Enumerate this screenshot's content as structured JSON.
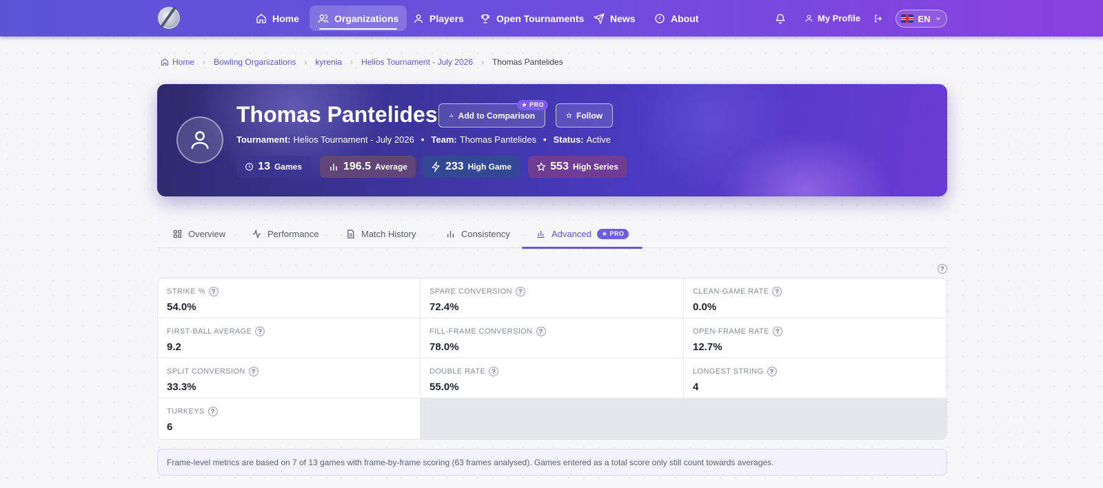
{
  "nav": {
    "items": [
      {
        "label": "Home",
        "icon": "home-icon"
      },
      {
        "label": "Organizations",
        "icon": "users-icon",
        "active": true
      },
      {
        "label": "Players",
        "icon": "user-icon"
      },
      {
        "label": "Open Tournaments",
        "icon": "trophy-icon"
      },
      {
        "label": "News",
        "icon": "send-icon"
      },
      {
        "label": "About",
        "icon": "info-icon"
      }
    ],
    "my_profile": "My Profile",
    "language": "EN"
  },
  "breadcrumb": {
    "home": "Home",
    "organizations": "Bowling Organizations",
    "org": "kyrenia",
    "tournament": "Helios Tournament - July 2026",
    "current": "Thomas Pantelides"
  },
  "player": {
    "name": "Thomas Pantelides",
    "add_comparison": "Add to Comparison",
    "pro_badge": "★ PRO",
    "follow": "Follow",
    "tournament_label": "Tournament:",
    "tournament": "Helios Tournament - July 2026",
    "team_label": "Team:",
    "team": "Thomas Pantelides",
    "status_label": "Status:",
    "status": "Active",
    "separator": "•"
  },
  "stats": {
    "games": {
      "value": "13",
      "label": "Games",
      "color": "#3b3790"
    },
    "average": {
      "value": "196.5",
      "label": "Average",
      "color": "#6a4a6e"
    },
    "high_game": {
      "value": "233",
      "label": "High Game",
      "color": "#2f4d8e"
    },
    "high_series": {
      "value": "553",
      "label": "High Series",
      "color": "#7a3d8c"
    }
  },
  "tabs": {
    "overview": "Overview",
    "performance": "Performance",
    "match_history": "Match History",
    "consistency": "Consistency",
    "advanced": "Advanced",
    "advanced_pro": "★ PRO"
  },
  "help_glyph": "?",
  "metrics": [
    {
      "label": "STRIKE %",
      "value": "54.0%"
    },
    {
      "label": "SPARE CONVERSION",
      "value": "72.4%"
    },
    {
      "label": "CLEAN-GAME RATE",
      "value": "0.0%"
    },
    {
      "label": "FIRST-BALL AVERAGE",
      "value": "9.2"
    },
    {
      "label": "FILL-FRAME CONVERSION",
      "value": "78.0%"
    },
    {
      "label": "OPEN-FRAME RATE",
      "value": "12.7%"
    },
    {
      "label": "SPLIT CONVERSION",
      "value": "33.3%"
    },
    {
      "label": "DOUBLE RATE",
      "value": "55.0%"
    },
    {
      "label": "LONGEST STRING",
      "value": "4"
    },
    {
      "label": "TURKEYS",
      "value": "6"
    }
  ],
  "note": "Frame-level metrics are based on 7 of 13 games with frame-by-frame scoring (63 frames analysed). Games entered as a total score only still count towards averages.",
  "colors": {
    "accent": "#6b55e0",
    "nav_gradient_start": "#5b55d6",
    "nav_gradient_end": "#8a3fe0"
  }
}
